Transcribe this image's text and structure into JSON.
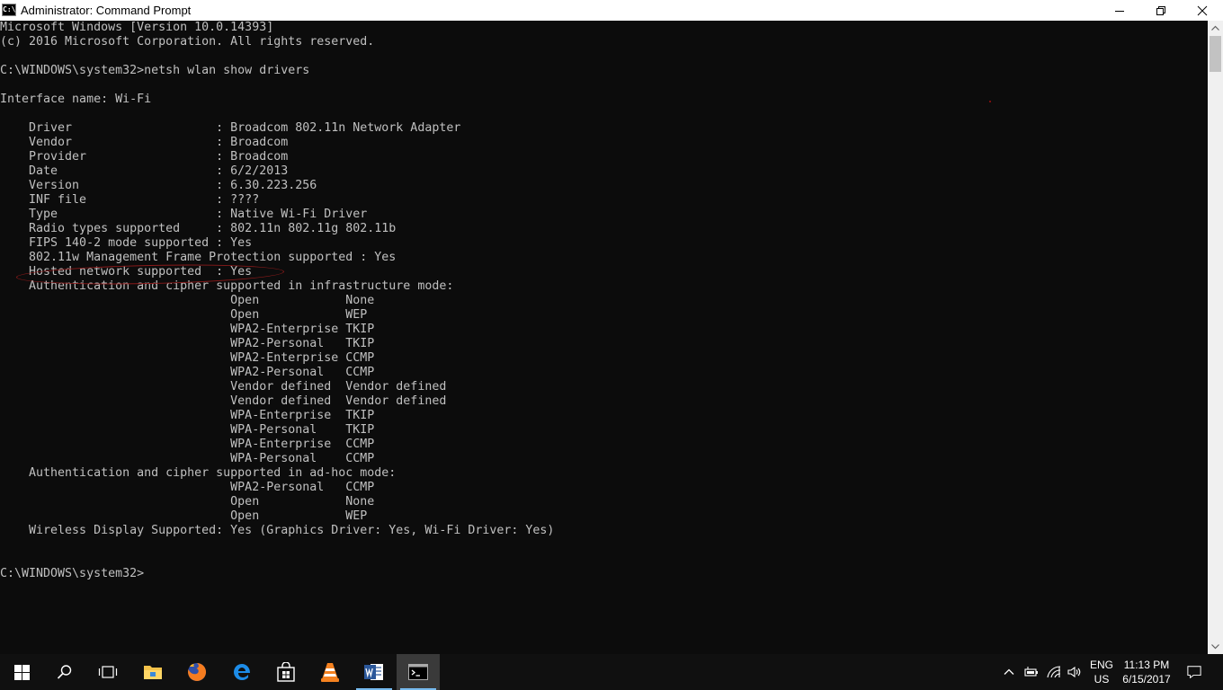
{
  "window": {
    "title": "Administrator: Command Prompt",
    "icon_text": "C:\\"
  },
  "console": {
    "lines": [
      "Microsoft Windows [Version 10.0.14393]",
      "(c) 2016 Microsoft Corporation. All rights reserved.",
      "",
      "C:\\WINDOWS\\system32>netsh wlan show drivers",
      "",
      "Interface name: Wi-Fi",
      "",
      "    Driver                    : Broadcom 802.11n Network Adapter",
      "    Vendor                    : Broadcom",
      "    Provider                  : Broadcom",
      "    Date                      : 6/2/2013",
      "    Version                   : 6.30.223.256",
      "    INF file                  : ????",
      "    Type                      : Native Wi-Fi Driver",
      "    Radio types supported     : 802.11n 802.11g 802.11b",
      "    FIPS 140-2 mode supported : Yes",
      "    802.11w Management Frame Protection supported : Yes",
      "    Hosted network supported  : Yes",
      "    Authentication and cipher supported in infrastructure mode:",
      "                                Open            None",
      "                                Open            WEP",
      "                                WPA2-Enterprise TKIP",
      "                                WPA2-Personal   TKIP",
      "                                WPA2-Enterprise CCMP",
      "                                WPA2-Personal   CCMP",
      "                                Vendor defined  Vendor defined",
      "                                Vendor defined  Vendor defined",
      "                                WPA-Enterprise  TKIP",
      "                                WPA-Personal    TKIP",
      "                                WPA-Enterprise  CCMP",
      "                                WPA-Personal    CCMP",
      "    Authentication and cipher supported in ad-hoc mode:",
      "                                WPA2-Personal   CCMP",
      "                                Open            None",
      "                                Open            WEP",
      "    Wireless Display Supported: Yes (Graphics Driver: Yes, Wi-Fi Driver: Yes)",
      "",
      "",
      "C:\\WINDOWS\\system32>"
    ]
  },
  "taskbar": {
    "apps": [
      {
        "name": "start-button-windows-icon"
      },
      {
        "name": "search-icon"
      },
      {
        "name": "task-view-icon"
      },
      {
        "name": "file-explorer-icon"
      },
      {
        "name": "firefox-icon"
      },
      {
        "name": "edge-icon"
      },
      {
        "name": "store-icon"
      },
      {
        "name": "vlc-icon"
      },
      {
        "name": "word-icon"
      },
      {
        "name": "command-prompt-icon"
      }
    ],
    "tray": {
      "lang_top": "ENG",
      "lang_bottom": "US",
      "time": "11:13 PM",
      "date": "6/15/2017"
    }
  },
  "colors": {
    "console_bg": "#0c0c0c",
    "console_fg": "#c0c0c0",
    "annotation": "#8b1a1a",
    "taskbar_bg": "#101010",
    "accent": "#76b9ed"
  }
}
